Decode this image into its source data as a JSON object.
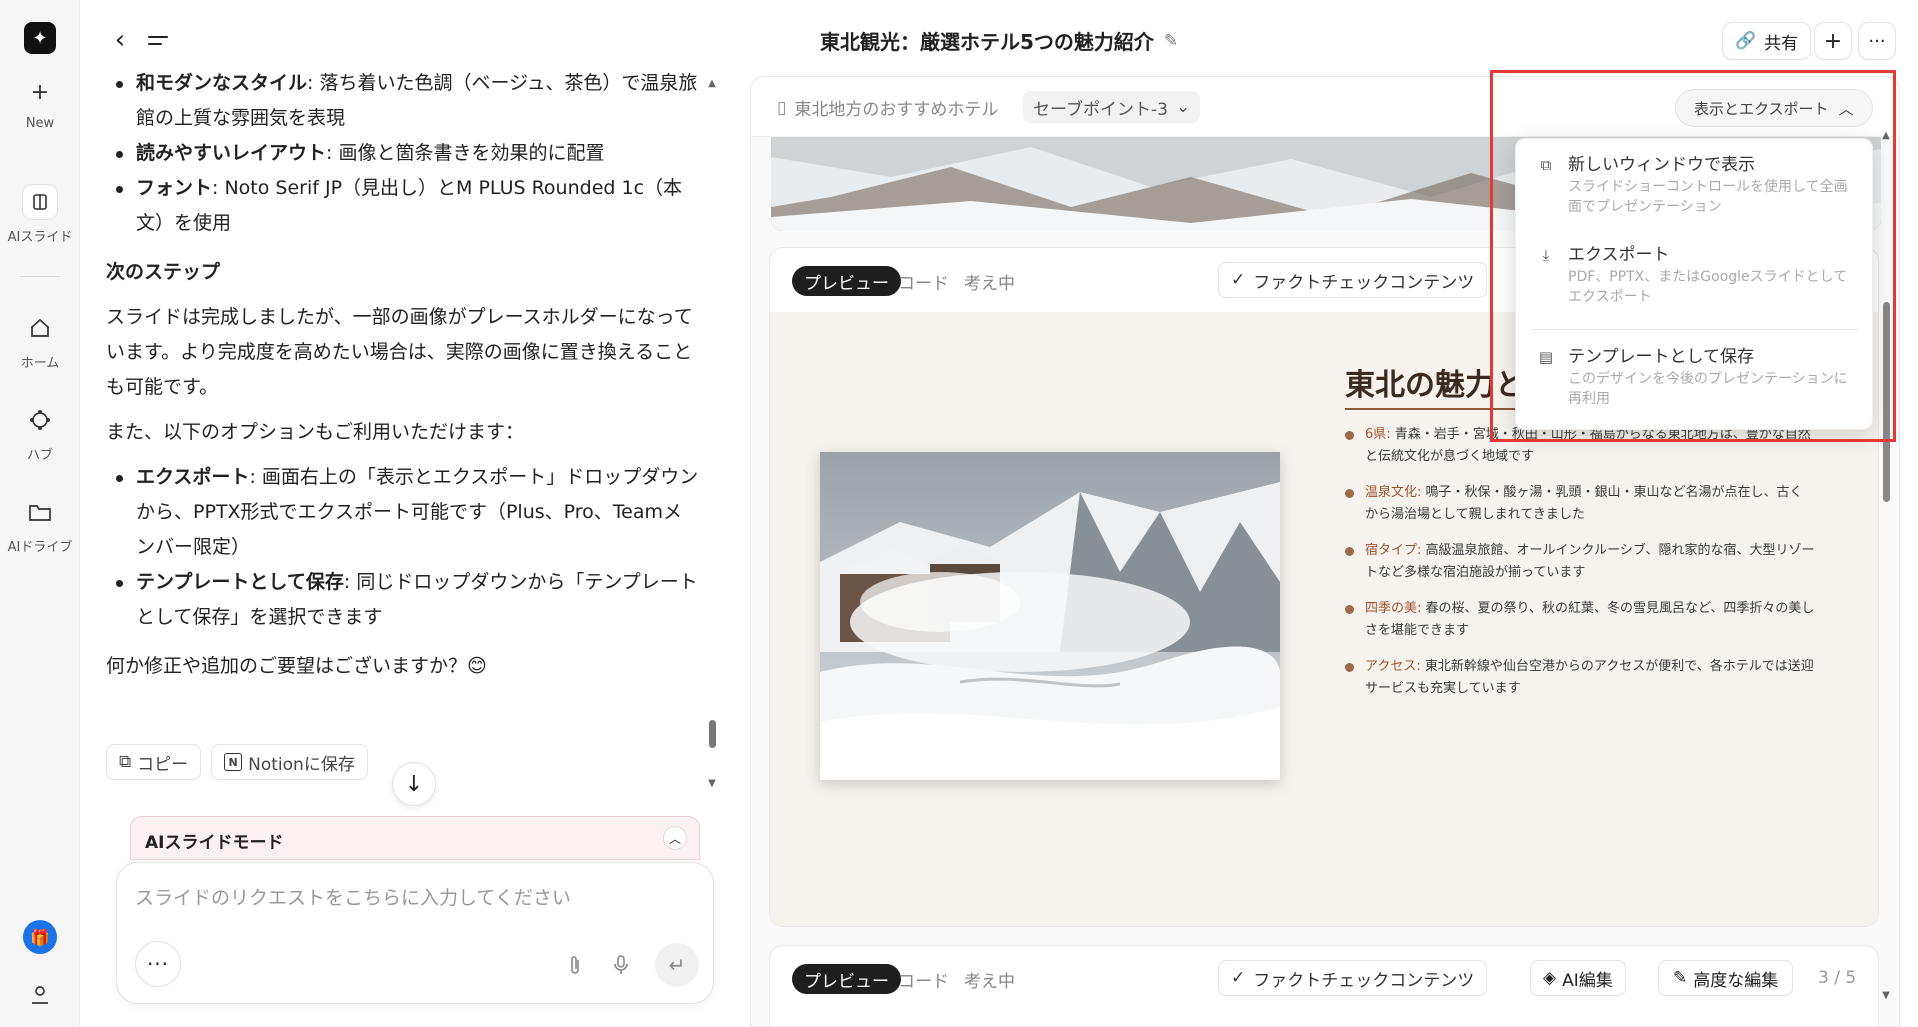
{
  "rail": {
    "new_label": "New",
    "slides_label": "AIスライド",
    "home_label": "ホーム",
    "hub_label": "ハブ",
    "drive_label": "AIドライブ"
  },
  "chat": {
    "bullet_1_bold": "和モダンなスタイル",
    "bullet_1_text": ": 落ち着いた色調（ベージュ、茶色）で温泉旅館の上質な雰囲気を表現",
    "bullet_2_bold": "読みやすいレイアウト",
    "bullet_2_text": ": 画像と箇条書きを効果的に配置",
    "bullet_3_bold": "フォント",
    "bullet_3_text": ": Noto Serif JP（見出し）とM PLUS Rounded 1c（本文）を使用",
    "next_heading": "次のステップ",
    "para_1": "スライドは完成しましたが、一部の画像がプレースホルダーになっています。より完成度を高めたい場合は、実際の画像に置き換えることも可能です。",
    "para_2": "また、以下のオプションもご利用いただけます：",
    "opt_1_bold": "エクスポート",
    "opt_1_text": ": 画面右上の「表示とエクスポート」ドロップダウンから、PPTX形式でエクスポート可能です（Plus、Pro、Teamメンバー限定）",
    "opt_2_bold": "テンプレートとして保存",
    "opt_2_text": ": 同じドロップダウンから「テンプレートとして保存」を選択できます",
    "question": "何か修正や追加のご要望はございますか？😊",
    "copy_label": "コピー",
    "notion_label": "Notionに保存",
    "mode_label": "AIスライドモード",
    "input_placeholder": "スライドのリクエストをこちらに入力してください"
  },
  "header": {
    "title": "東北観光：厳選ホテル5つの魅力紹介",
    "share_label": "共有"
  },
  "panel": {
    "breadcrumb": "東北地方のおすすめホテル",
    "savepoint": "セーブポイント-3",
    "export_label": "表示とエクスポート",
    "tabs": [
      "プレビュー",
      "コード",
      "考え中"
    ],
    "factcheck_label": "ファクトチェックコンテンツ",
    "ai_edit_label": "AI編集",
    "adv_edit_label": "高度な編集",
    "pager": "3 / 5"
  },
  "slide": {
    "title": "東北の魅力と",
    "items": [
      {
        "key": "6県:",
        "text": " 青森・岩手・宮城・秋田・山形・福島からなる東北地方は、豊かな自然と伝統文化が息づく地域です"
      },
      {
        "key": "温泉文化:",
        "text": " 鳴子・秋保・酸ヶ湯・乳頭・銀山・東山など名湯が点在し、古くから湯治場として親しまれてきました"
      },
      {
        "key": "宿タイプ:",
        "text": " 高級温泉旅館、オールインクルーシブ、隠れ家的な宿、大型リゾートなど多様な宿泊施設が揃っています"
      },
      {
        "key": "四季の美:",
        "text": " 春の桜、夏の祭り、秋の紅葉、冬の雪見風呂など、四季折々の美しさを堪能できます"
      },
      {
        "key": "アクセス:",
        "text": " 東北新幹線や仙台空港からのアクセスが便利で、各ホテルでは送迎サービスも充実しています"
      }
    ]
  },
  "dropdown": {
    "items": [
      {
        "title": "新しいウィンドウで表示",
        "desc": "スライドショーコントロールを使用して全画面でプレゼンテーション"
      },
      {
        "title": "エクスポート",
        "desc": "PDF、PPTX、またはGoogleスライドとしてエクスポート"
      },
      {
        "title": "テンプレートとして保存",
        "desc": "このデザインを今後のプレゼンテーションに再利用"
      }
    ]
  },
  "colors": {
    "accent_blue": "#1a73e8",
    "highlight_red": "#e53935",
    "slide_bg": "#f6f2ee",
    "slide_key": "#a0522d"
  }
}
